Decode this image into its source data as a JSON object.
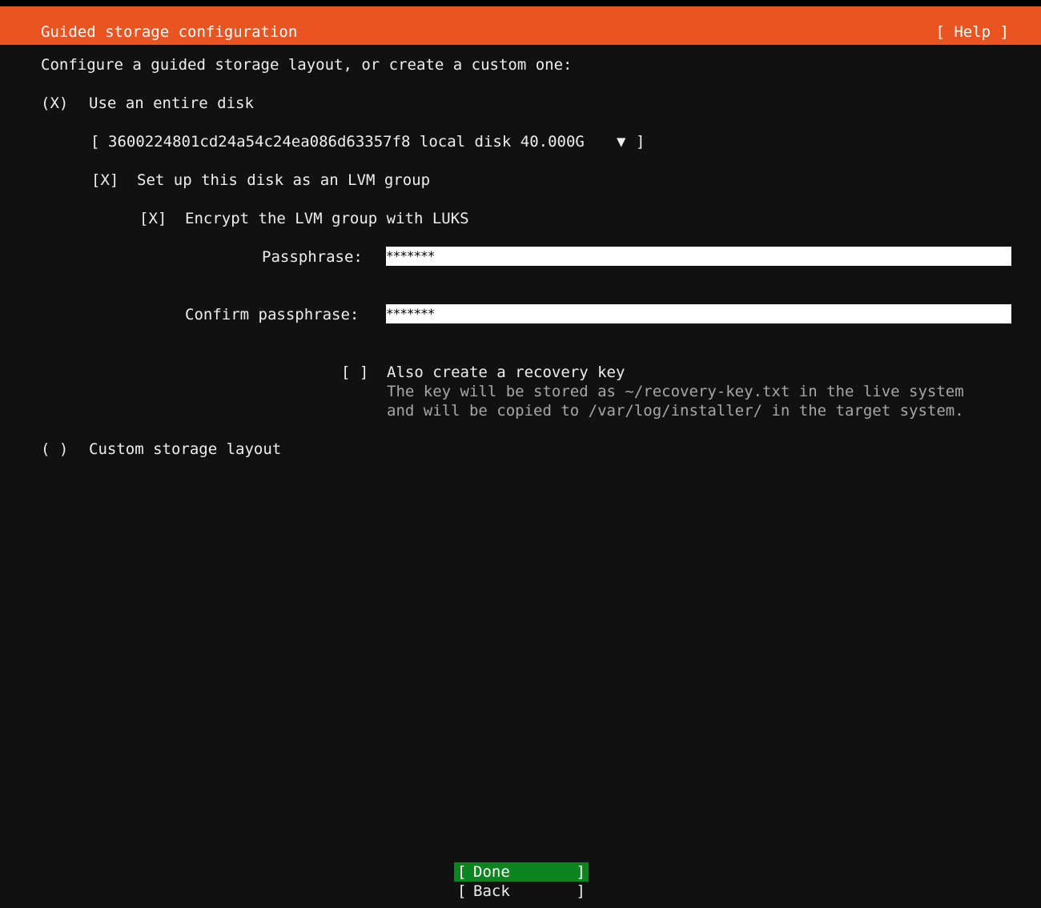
{
  "header": {
    "title": "Guided storage configuration",
    "help_label": "[ Help ]",
    "background": "#e95420"
  },
  "main": {
    "intro": "Configure a guided storage layout, or create a custom one:",
    "entire_disk": {
      "radio": "(X)",
      "label": "Use an entire disk",
      "disk_select": {
        "open_bracket": "[",
        "value": "3600224801cd24a54c24ea086d63357f8 local disk 40.000G",
        "arrow": "▼",
        "close_bracket": "]"
      }
    },
    "lvm": {
      "checkbox": "[X]",
      "label": "Set up this disk as an LVM group"
    },
    "luks": {
      "checkbox": "[X]",
      "label": "Encrypt the LVM group with LUKS"
    },
    "passphrase": {
      "label": "Passphrase:",
      "value": "*******"
    },
    "confirm_passphrase": {
      "label": "Confirm passphrase:",
      "value": "*******"
    },
    "recovery_key": {
      "checkbox": "[ ]",
      "label": "Also create a recovery key",
      "help_line1": "The key will be stored as ~/recovery-key.txt in the live system",
      "help_line2": "and will be copied to /var/log/installer/ in the target system."
    },
    "custom": {
      "radio": "( )",
      "label": "Custom storage layout"
    }
  },
  "footer": {
    "done": {
      "open": "[",
      "label": "Done",
      "close": "]",
      "color": "#0e8420"
    },
    "back": {
      "open": "[",
      "label": "Back",
      "close": "]"
    }
  }
}
